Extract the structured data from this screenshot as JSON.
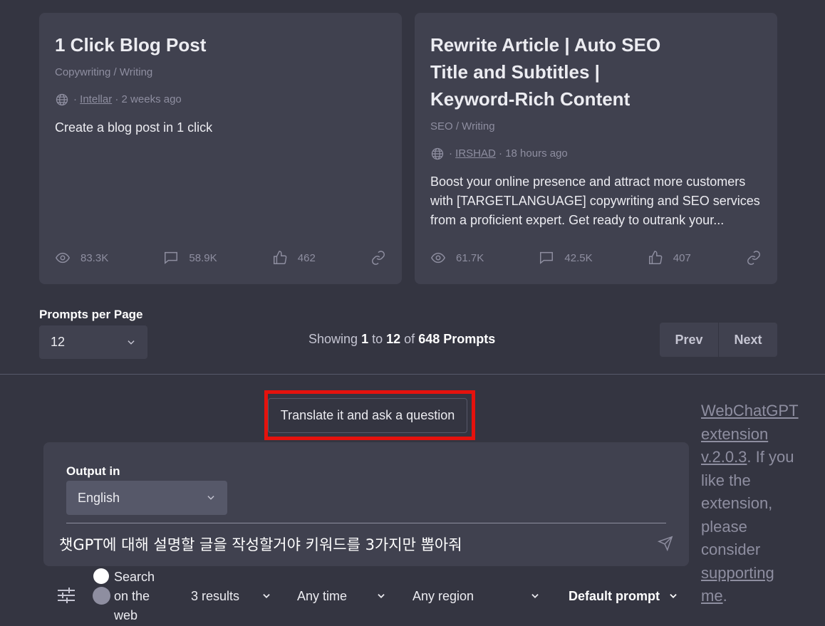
{
  "cards": [
    {
      "title": "1 Click Blog Post",
      "category": "Copywriting / Writing",
      "author": "Intellar",
      "time": "2 weeks ago",
      "description": "Create a blog post in 1 click",
      "views": "83.3K",
      "comments": "58.9K",
      "likes": "462"
    },
    {
      "title": "Rewrite Article | Auto SEO Title and Subtitles | Keyword-Rich Content",
      "category": "SEO / Writing",
      "author": "IRSHAD",
      "time": "18 hours ago",
      "description": "Boost your online presence and attract more customers with [TARGETLANGUAGE] copywriting and SEO services from a proficient expert. Get ready to outrank your...",
      "views": "61.7K",
      "comments": "42.5K",
      "likes": "407"
    }
  ],
  "pagination": {
    "per_page_label": "Prompts per Page",
    "per_page_value": "12",
    "showing_prefix": "Showing",
    "from": "1",
    "to_word": "to",
    "to": "12",
    "of_word": "of",
    "total": "648 Prompts",
    "prev_label": "Prev",
    "next_label": "Next"
  },
  "translate_button": "Translate it and ask a question",
  "input_panel": {
    "output_label": "Output in",
    "language": "English",
    "prompt": "챗GPT에 대해 설명할 글을 작성할거야 키워드를 3가지만 뽑아줘"
  },
  "side_note": {
    "link1": "WebChatGPT extension v.2.0.3",
    "middle": ". If you like the extension, please consider ",
    "link2": "supporting me",
    "end": "."
  },
  "toolbar": {
    "search_label": "Search on the web",
    "results": "3 results",
    "time": "Any time",
    "region": "Any region",
    "prompt": "Default prompt"
  },
  "colors": {
    "background": "#343541",
    "card": "#40414f",
    "highlight_border": "#e5120d"
  }
}
